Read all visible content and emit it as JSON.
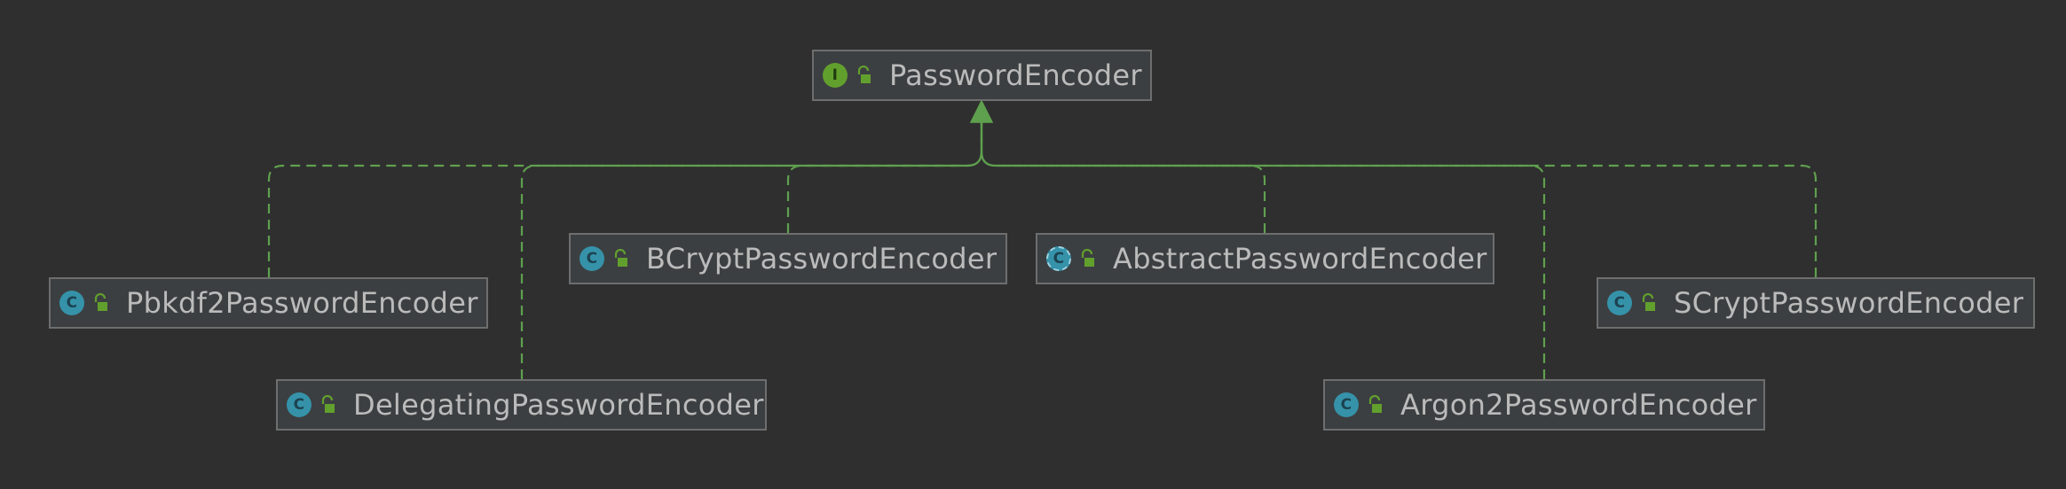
{
  "colors": {
    "background": "#2f2f2f",
    "node_fill": "#3c3f41",
    "node_border": "#6e6e6e",
    "text": "#bbbbbb",
    "edge": "#5fa04e",
    "class_badge": "#3592a9",
    "interface_badge": "#62a02e"
  },
  "diagram": {
    "root": {
      "name": "PasswordEncoder",
      "kind": "interface",
      "badge_letter": "I",
      "icon": "interface-icon"
    },
    "implementations": [
      {
        "name": "Pbkdf2PasswordEncoder",
        "kind": "class",
        "badge_letter": "C",
        "icon": "class-icon"
      },
      {
        "name": "DelegatingPasswordEncoder",
        "kind": "class",
        "badge_letter": "C",
        "icon": "class-icon"
      },
      {
        "name": "BCryptPasswordEncoder",
        "kind": "class",
        "badge_letter": "C",
        "icon": "class-icon"
      },
      {
        "name": "AbstractPasswordEncoder",
        "kind": "abstract-class",
        "badge_letter": "C",
        "icon": "abstract-class-icon"
      },
      {
        "name": "Argon2PasswordEncoder",
        "kind": "class",
        "badge_letter": "C",
        "icon": "class-icon"
      },
      {
        "name": "SCryptPasswordEncoder",
        "kind": "class",
        "badge_letter": "C",
        "icon": "class-icon"
      }
    ],
    "relation": "implements"
  }
}
